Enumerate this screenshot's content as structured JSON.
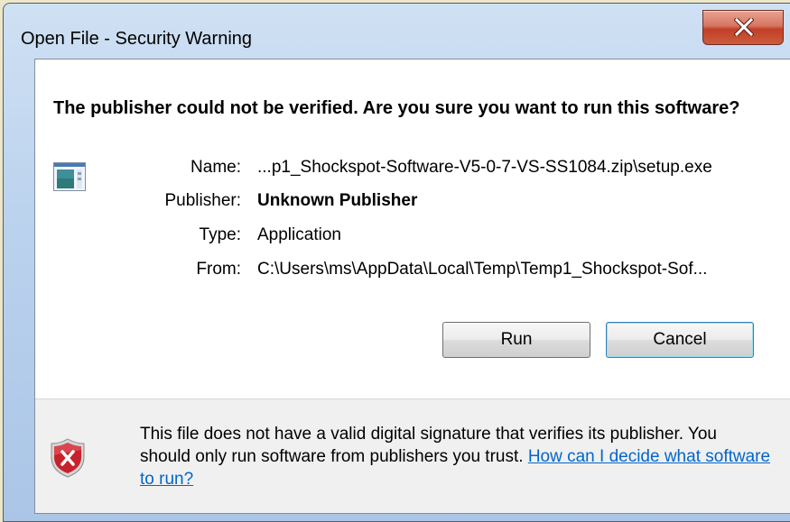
{
  "window": {
    "title": "Open File - Security Warning",
    "close_glyph": "X"
  },
  "headline": "The publisher could not be verified.  Are you sure you want to run this software?",
  "details": {
    "name_label": "Name:",
    "name_value": "...p1_Shockspot-Software-V5-0-7-VS-SS1084.zip\\setup.exe",
    "publisher_label": "Publisher:",
    "publisher_value": "Unknown Publisher",
    "type_label": "Type:",
    "type_value": "Application",
    "from_label": "From:",
    "from_value": "C:\\Users\\ms\\AppData\\Local\\Temp\\Temp1_Shockspot-Sof..."
  },
  "buttons": {
    "run": "Run",
    "cancel": "Cancel"
  },
  "footer": {
    "message": "This file does not have a valid digital signature that verifies its publisher. You should only run software from publishers you trust. ",
    "link": "How can I decide what software to run?"
  },
  "icons": {
    "app": "application-icon",
    "warning": "security-shield-icon",
    "close": "close-icon"
  },
  "colors": {
    "link": "#0066cc",
    "close_button": "#c13f26",
    "shield": "#c8212b"
  }
}
